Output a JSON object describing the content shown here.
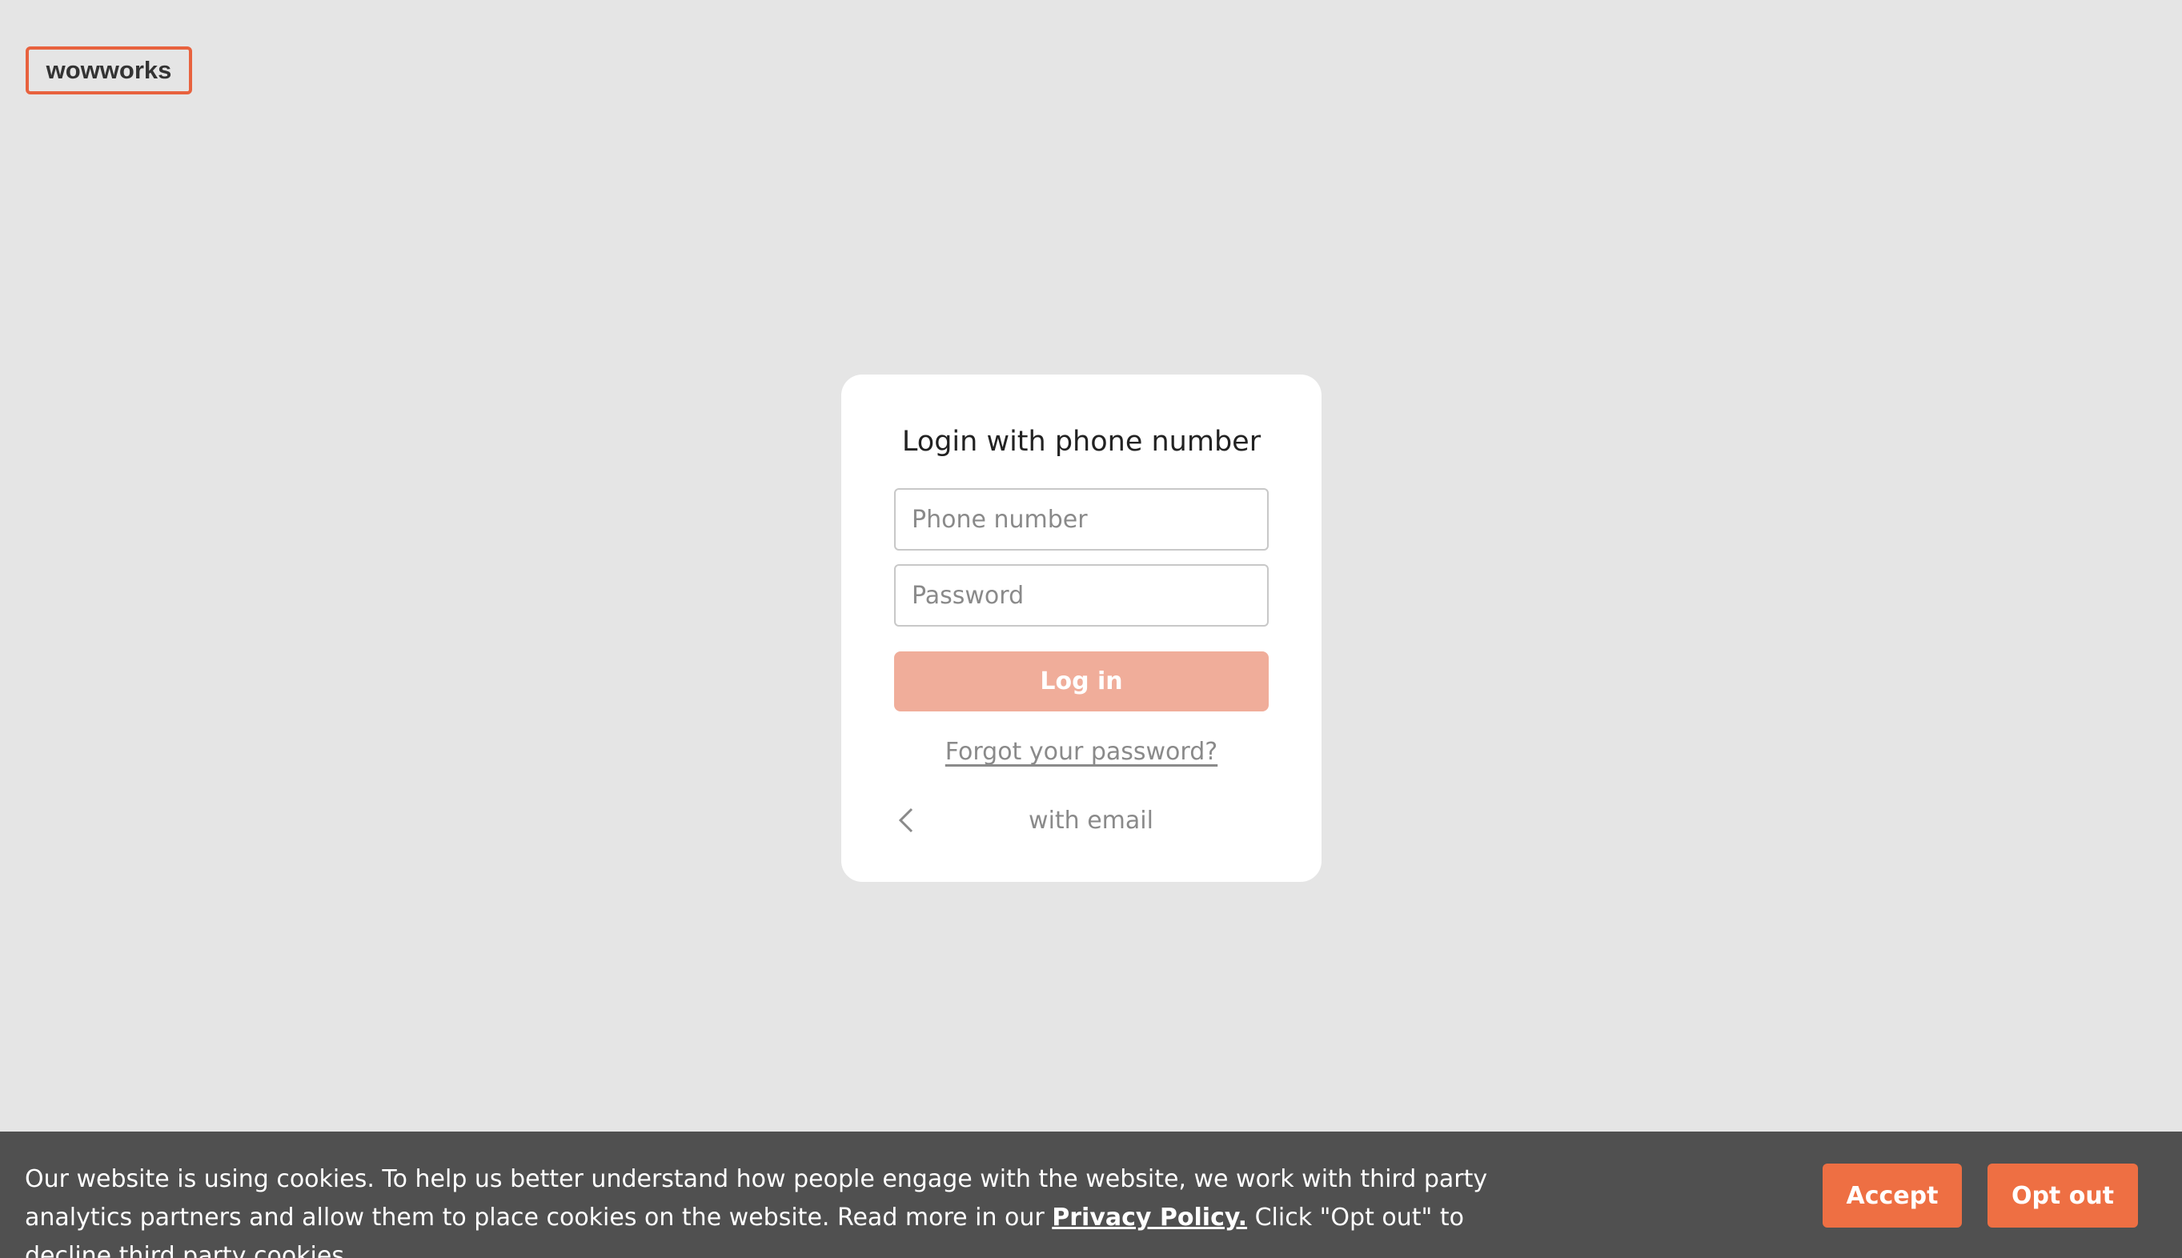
{
  "brand": {
    "logo_text": "wowworks",
    "accent_color": "#e8623e"
  },
  "login_card": {
    "title": "Login with phone number",
    "phone_placeholder": "Phone number",
    "password_placeholder": "Password",
    "login_label": "Log in",
    "forgot_password_label": "Forgot your password?",
    "back_icon": "chevron-left-icon",
    "with_email_label": "with email"
  },
  "cookie_banner": {
    "text_before_link": "Our website is using cookies. To help us better understand how people engage with the website, we work with third party analytics partners and allow them to place cookies on the website. Read more in our ",
    "privacy_link_label": "Privacy Policy.",
    "text_after_link": " Click \"Opt out\" to decline third party cookies.",
    "accept_label": "Accept",
    "optout_label": "Opt out",
    "button_color": "#ee6f43"
  }
}
